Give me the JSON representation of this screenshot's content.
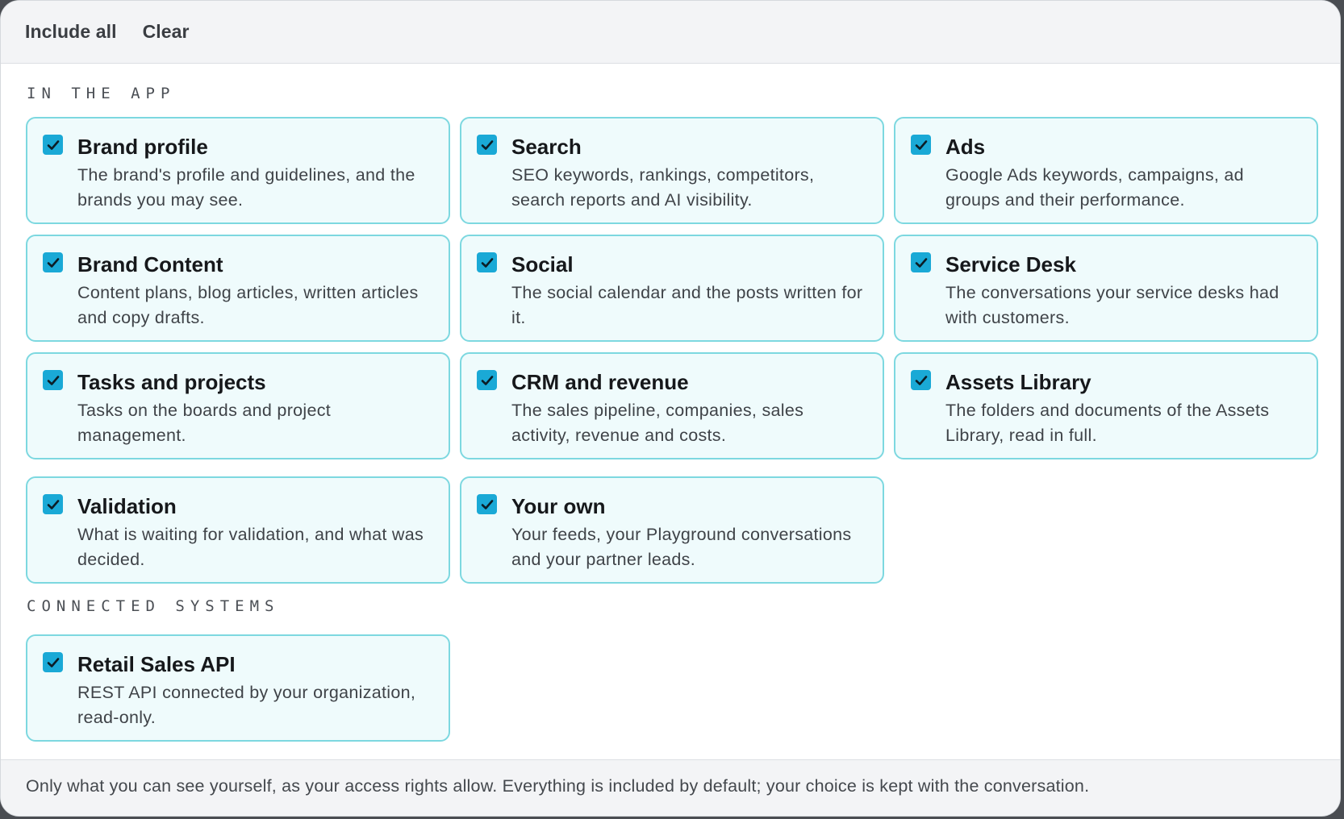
{
  "toolbar": {
    "include_all_label": "Include all",
    "clear_label": "Clear"
  },
  "sections": {
    "in_app_label": "IN THE APP",
    "connected_label": "CONNECTED SYSTEMS"
  },
  "cards": [
    {
      "title": "Brand profile",
      "description": "The brand's profile and guidelines, and the brands you may see.",
      "checked": true
    },
    {
      "title": "Search",
      "description": "SEO keywords, rankings, competitors, search reports and AI visibility.",
      "checked": true
    },
    {
      "title": "Ads",
      "description": "Google Ads keywords, campaigns, ad groups and their performance.",
      "checked": true
    },
    {
      "title": "Brand Content",
      "description": "Content plans, blog articles, written articles and copy drafts.",
      "checked": true
    },
    {
      "title": "Social",
      "description": "The social calendar and the posts written for it.",
      "checked": true
    },
    {
      "title": "Service Desk",
      "description": "The conversations your service desks had with customers.",
      "checked": true
    },
    {
      "title": "Tasks and projects",
      "description": "Tasks on the boards and project management.",
      "checked": true
    },
    {
      "title": "CRM and revenue",
      "description": "The sales pipeline, companies, sales activity, revenue and costs.",
      "checked": true
    },
    {
      "title": "Assets Library",
      "description": "The folders and documents of the Assets Library, read in full.",
      "checked": true
    },
    {
      "title": "Validation",
      "description": "What is waiting for validation, and what was decided.",
      "checked": true
    },
    {
      "title": "Your own",
      "description": "Your feeds, your Playground conversations and your partner leads.",
      "checked": true
    }
  ],
  "connected_cards": [
    {
      "title": "Retail Sales API",
      "description": "REST API connected by your organization, read-only.",
      "checked": true
    }
  ],
  "footer": {
    "note": "Only what you can see yourself, as your access rights allow. Everything is included by default; your choice is kept with the conversation."
  },
  "colors": {
    "accent": "#1aa9d6",
    "card_border": "#7dd8e0",
    "card_background": "#effbfc"
  },
  "icons": {
    "checkbox": "checkmark-icon"
  }
}
